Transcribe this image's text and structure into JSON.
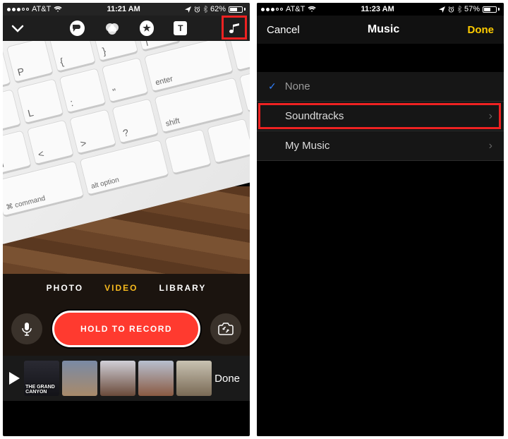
{
  "left": {
    "status": {
      "carrier": "AT&T",
      "time": "11:21 AM",
      "battery_pct": "62%"
    },
    "toolbar_icons": {
      "chevron": "chevron-down",
      "comment": "speech-bubble",
      "filter": "overlapping-circles",
      "star": "star",
      "text": "T",
      "music": "music-note"
    },
    "modes": {
      "photo": "PHOTO",
      "video": "VIDEO",
      "library": "LIBRARY"
    },
    "record_label": "HOLD TO RECORD",
    "clips_done": "Done",
    "clip_labels": {
      "first": "THE GRAND CANYON"
    }
  },
  "right": {
    "status": {
      "carrier": "AT&T",
      "time": "11:23 AM",
      "battery_pct": "57%"
    },
    "nav": {
      "cancel": "Cancel",
      "title": "Music",
      "done": "Done"
    },
    "rows": {
      "none": "None",
      "soundtracks": "Soundtracks",
      "my_music": "My Music"
    }
  }
}
